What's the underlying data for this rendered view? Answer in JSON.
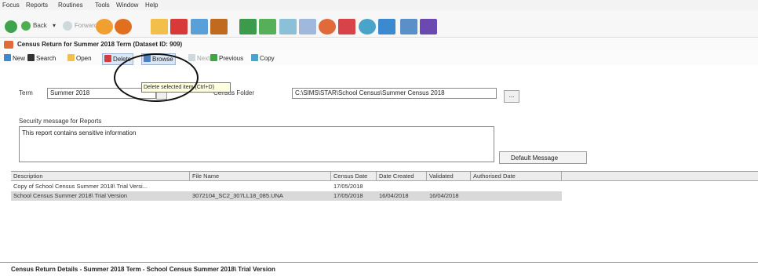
{
  "menu": [
    "Focus",
    "Reports",
    "Routines",
    "Tools",
    "Window",
    "Help"
  ],
  "nav": {
    "back": "Back",
    "forward": "Forward"
  },
  "window_title": "Census Return for Summer 2018 Term (Dataset ID: 909)",
  "toolbar": {
    "new": "New",
    "search": "Search",
    "open": "Open",
    "delete": "Delete",
    "browse": "Browse",
    "next": "Next",
    "previous": "Previous",
    "copy": "Copy"
  },
  "tooltip": "Delete selected item (Ctrl+D)",
  "form": {
    "term_label": "Term",
    "term_value": "Summer 2018",
    "census_folder_label": "Census Folder",
    "census_folder_value": "C:\\SIMS\\STAR\\School Census\\Summer Census 2018",
    "browse_btn": "...",
    "security_label": "Security message for Reports",
    "security_message": "This report contains sensitive information",
    "default_message_btn": "Default Message"
  },
  "grid": {
    "columns": [
      "Description",
      "File Name",
      "Census Date",
      "Date Created",
      "Validated",
      "Authorised Date"
    ],
    "rows": [
      [
        "Copy of School Census Summer 2018\\ Trial Versi...",
        "",
        "17/05/2018",
        "",
        "",
        ""
      ],
      [
        "School Census Summer 2018\\ Trial Version",
        "3072104_SC2_307LL18_085.UNA",
        "17/05/2018",
        "16/04/2018",
        "16/04/2018",
        ""
      ]
    ]
  },
  "footer": "Census Return Details - Summer 2018 Term - School Census Summer 2018\\ Trial Version"
}
